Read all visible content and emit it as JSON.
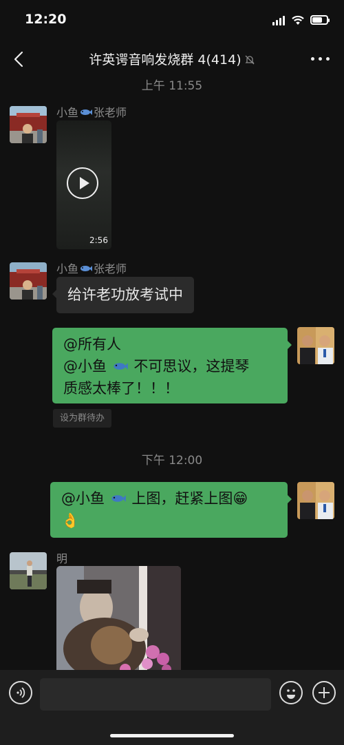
{
  "status": {
    "time": "12:20"
  },
  "nav": {
    "title": "许英谔音响发烧群 4(414)",
    "back_icon": "chevron-left-icon",
    "more_icon": "more-dots-icon",
    "mute_icon": "bell-muted-icon"
  },
  "messages": {
    "stamp1": "上午 11:55",
    "msg1": {
      "sender_a": "小鱼",
      "sender_b": "张老师",
      "video_duration": "2:56"
    },
    "msg2": {
      "sender_a": "小鱼",
      "sender_b": "张老师",
      "text": "给许老功放考试中"
    },
    "msg3": {
      "line1": "@所有人",
      "line2a": "@小鱼",
      "line2b": "不可思议，这提琴",
      "line3": "质感太棒了！！！",
      "todo": "设为群待办"
    },
    "stamp2": "下午 12:00",
    "msg4": {
      "text_a": "@小鱼",
      "text_b": "上图，赶紧上图😁",
      "text_c": "👌"
    },
    "msg5": {
      "sender": "明"
    }
  },
  "inputbar": {
    "voice_icon": "voice-icon",
    "emoji_icon": "emoji-icon",
    "plus_icon": "plus-icon"
  }
}
